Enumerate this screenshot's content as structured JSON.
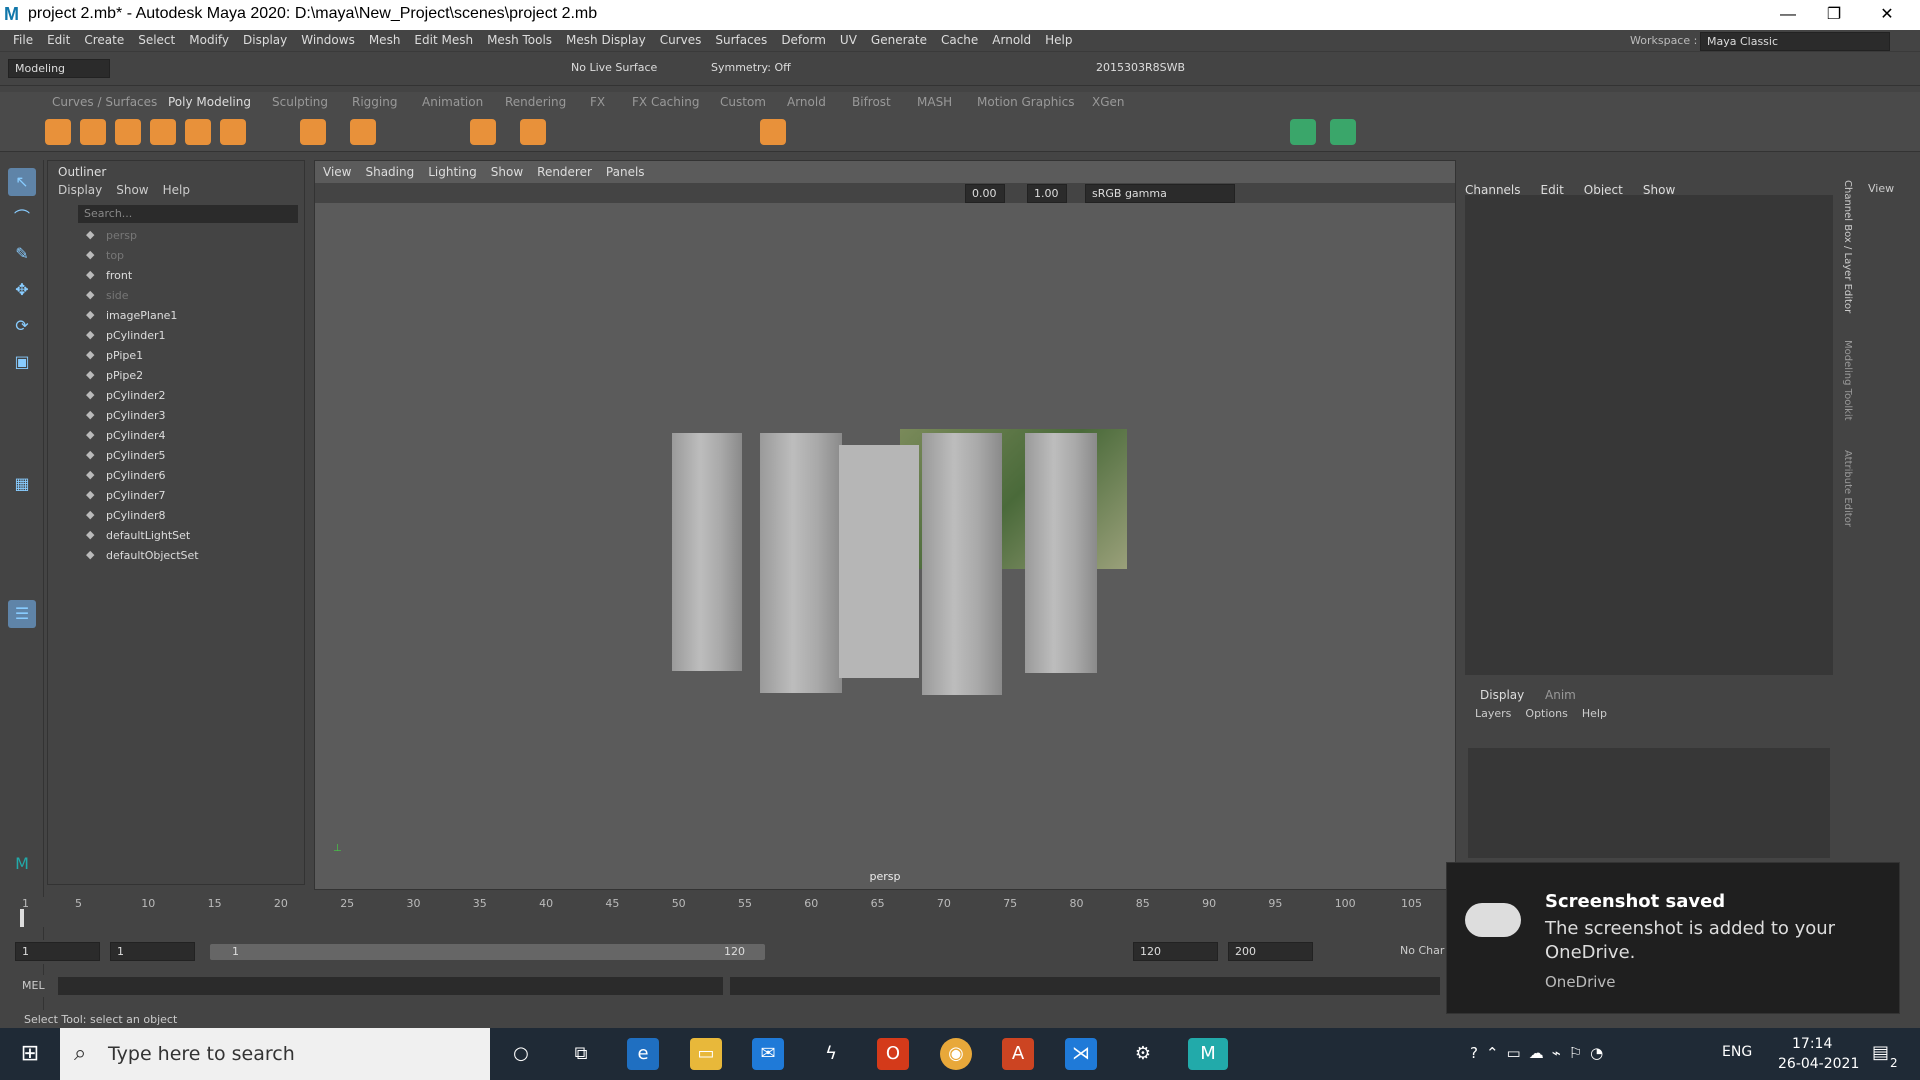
{
  "window": {
    "title": "project 2.mb* - Autodesk Maya 2020: D:\\maya\\New_Project\\scenes\\project 2.mb",
    "min": "—",
    "max": "❐",
    "close": "✕"
  },
  "menubar": [
    "File",
    "Edit",
    "Create",
    "Select",
    "Modify",
    "Display",
    "Windows",
    "Mesh",
    "Edit Mesh",
    "Mesh Tools",
    "Mesh Display",
    "Curves",
    "Surfaces",
    "Deform",
    "UV",
    "Generate",
    "Cache",
    "Arnold",
    "Help"
  ],
  "workspace": {
    "label": "Workspace :",
    "value": "Maya Classic"
  },
  "statusline": {
    "mode": "Modeling",
    "live_surface": "No Live Surface",
    "symmetry": "Symmetry: Off",
    "user": "2015303R8SWB"
  },
  "shelf_tabs": [
    "Curves / Surfaces",
    "Poly Modeling",
    "Sculpting",
    "Rigging",
    "Animation",
    "Rendering",
    "FX",
    "FX Caching",
    "Custom",
    "Arnold",
    "Bifrost",
    "MASH",
    "Motion Graphics",
    "XGen"
  ],
  "shelf_active": "Poly Modeling",
  "outliner": {
    "title": "Outliner",
    "menu": [
      "Display",
      "Show",
      "Help"
    ],
    "search_placeholder": "Search...",
    "items": [
      {
        "name": "persp",
        "dim": true
      },
      {
        "name": "top",
        "dim": true
      },
      {
        "name": "front",
        "dim": false
      },
      {
        "name": "side",
        "dim": true
      },
      {
        "name": "imagePlane1",
        "dim": false
      },
      {
        "name": "pCylinder1",
        "dim": false
      },
      {
        "name": "pPipe1",
        "dim": false
      },
      {
        "name": "pPipe2",
        "dim": false
      },
      {
        "name": "pCylinder2",
        "dim": false
      },
      {
        "name": "pCylinder3",
        "dim": false
      },
      {
        "name": "pCylinder4",
        "dim": false
      },
      {
        "name": "pCylinder5",
        "dim": false
      },
      {
        "name": "pCylinder6",
        "dim": false
      },
      {
        "name": "pCylinder7",
        "dim": false
      },
      {
        "name": "pCylinder8",
        "dim": false
      },
      {
        "name": "defaultLightSet",
        "dim": false
      },
      {
        "name": "defaultObjectSet",
        "dim": false
      }
    ]
  },
  "viewport": {
    "menu": [
      "View",
      "Shading",
      "Lighting",
      "Show",
      "Renderer",
      "Panels"
    ],
    "exposure": "0.00",
    "gamma": "1.00",
    "color_space": "sRGB gamma",
    "camera": "persp"
  },
  "channelbox": {
    "menu": [
      "Channels",
      "Edit",
      "Object",
      "Show"
    ],
    "side_tabs": [
      "Channel Box / Layer Editor",
      "Modeling Toolkit",
      "Attribute Editor"
    ]
  },
  "layer_editor": {
    "tabs": [
      "Display",
      "Anim"
    ],
    "menu": [
      "Layers",
      "Options",
      "Help"
    ]
  },
  "view_panel_label": "View",
  "timeline": {
    "ticks": [
      "1",
      "5",
      "10",
      "15",
      "20",
      "25",
      "30",
      "35",
      "40",
      "45",
      "50",
      "55",
      "60",
      "65",
      "70",
      "75",
      "80",
      "85",
      "90",
      "95",
      "100",
      "105"
    ]
  },
  "range": {
    "start": "1",
    "current": "1",
    "range_start": "1",
    "range_end": "120",
    "end": "120",
    "max": "200",
    "character": "No Char"
  },
  "cmdline": {
    "label": "MEL"
  },
  "helpline": "Select Tool: select an object",
  "taskbar": {
    "search": "Type here to search",
    "time": "17:14",
    "date": "26-04-2021",
    "lang": "ENG",
    "notif": "2"
  },
  "toast": {
    "title": "Screenshot saved",
    "body": "The screenshot is added to your OneDrive.",
    "source": "OneDrive"
  }
}
